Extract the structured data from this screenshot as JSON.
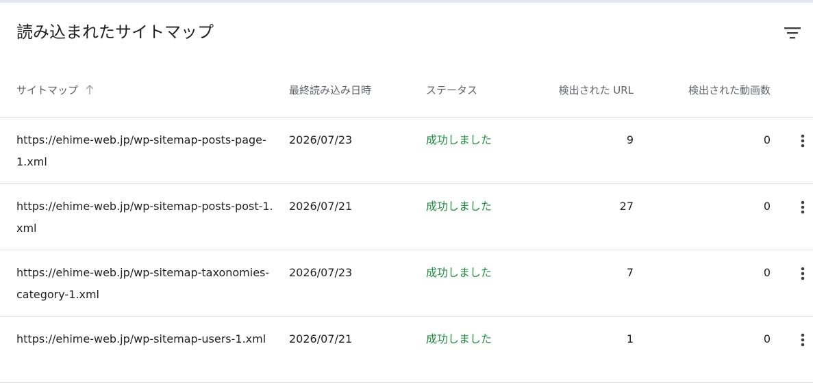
{
  "title": "読み込まれたサイトマップ",
  "columns": {
    "sitemap": "サイトマップ",
    "last_read": "最終読み込み日時",
    "status": "ステータス",
    "urls_found": "検出された URL",
    "videos_found": "検出された動画数"
  },
  "rows": [
    {
      "url": "https://ehime-web.jp/wp-sitemap-posts-page-1.xml",
      "date": "2026/07/23",
      "status": "成功しました",
      "urls": "9",
      "videos": "0"
    },
    {
      "url": "https://ehime-web.jp/wp-sitemap-posts-post-1.xml",
      "date": "2026/07/21",
      "status": "成功しました",
      "urls": "27",
      "videos": "0"
    },
    {
      "url": "https://ehime-web.jp/wp-sitemap-taxonomies-category-1.xml",
      "date": "2026/07/23",
      "status": "成功しました",
      "urls": "7",
      "videos": "0"
    },
    {
      "url": "https://ehime-web.jp/wp-sitemap-users-1.xml",
      "date": "2026/07/21",
      "status": "成功しました",
      "urls": "1",
      "videos": "0"
    }
  ],
  "colors": {
    "status_success": "#1e8e3e",
    "divider": "#e0e0e0",
    "header_text": "#5f6368"
  },
  "icons": {
    "filter": "filter-icon",
    "sort": "arrow-up-icon",
    "more": "more-vert-icon"
  }
}
